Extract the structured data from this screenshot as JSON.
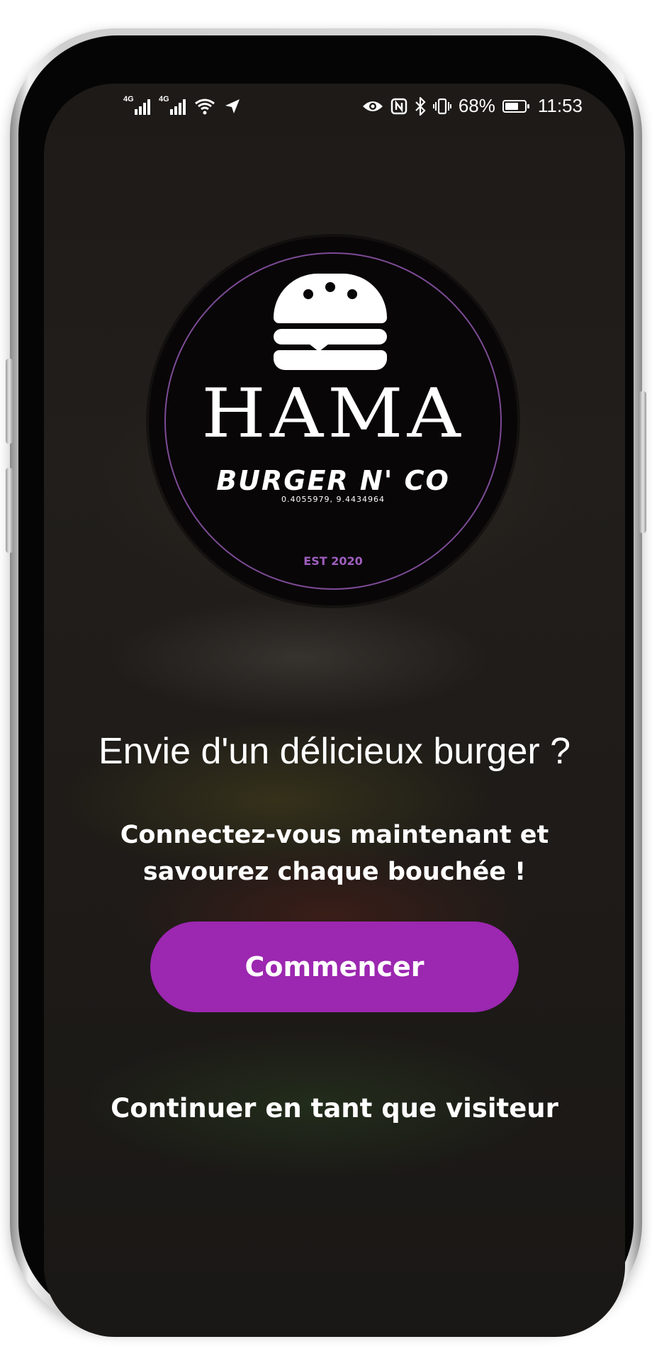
{
  "status_bar": {
    "network_1": "4G",
    "network_2": "4G",
    "battery_percent": "68%",
    "battery_level": 0.68,
    "time": "11:53",
    "icons": [
      "signal-icon",
      "signal-icon",
      "wifi-icon",
      "send-icon",
      "eye-icon",
      "nfc-icon",
      "bluetooth-icon",
      "vibrate-icon",
      "battery-icon"
    ]
  },
  "logo": {
    "brand_name": "HAMA",
    "brand_tagline": "BURGER N' CO",
    "coordinates": "0.4055979,  9.4434964",
    "established": "EST 2020",
    "icon": "burger-icon",
    "ring_color": "#7d4b96"
  },
  "welcome": {
    "headline": "Envie d'un délicieux burger ?",
    "subline_1": "Connectez-vous maintenant et",
    "subline_2": "savourez chaque bouchée !"
  },
  "actions": {
    "start_label": "Commencer",
    "guest_label": "Continuer en tant que visiteur"
  },
  "colors": {
    "accent": "#9c27b0",
    "background": "#1e1b18",
    "text": "#ffffff"
  }
}
